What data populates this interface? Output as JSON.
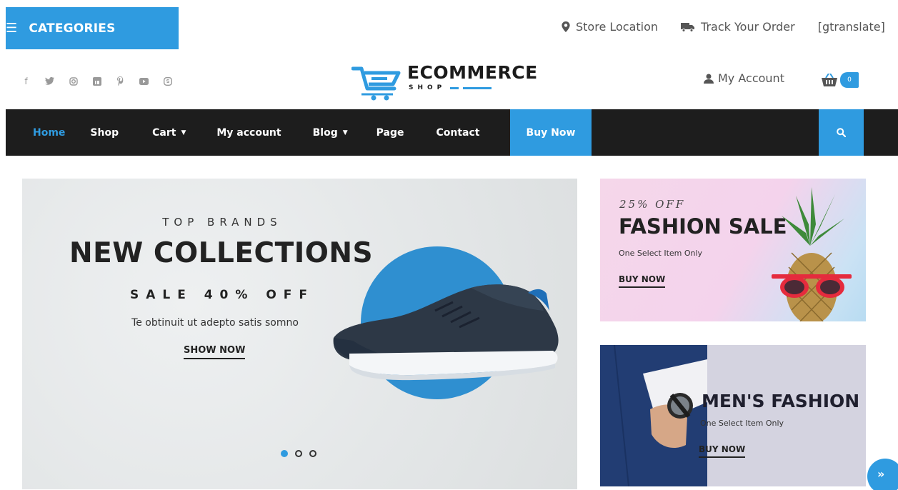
{
  "header": {
    "categories_label": "CATEGORIES",
    "store_location": "Store Location",
    "track_order": "Track Your Order",
    "translate": "[gtranslate]",
    "my_account": "My Account",
    "cart_count": "0"
  },
  "logo": {
    "main": "ECOMMERCE",
    "sub": "SHOP"
  },
  "social_icons": [
    "facebook-icon",
    "twitter-icon",
    "instagram-icon",
    "linkedin-icon",
    "pinterest-icon",
    "youtube-icon",
    "skype-icon"
  ],
  "nav": {
    "items": [
      {
        "label": "Home",
        "dropdown": false
      },
      {
        "label": "Shop",
        "dropdown": false
      },
      {
        "label": "Cart",
        "dropdown": true
      },
      {
        "label": "My account",
        "dropdown": false
      },
      {
        "label": "Blog",
        "dropdown": true
      },
      {
        "label": "Page",
        "dropdown": false
      },
      {
        "label": "Contact",
        "dropdown": false
      }
    ],
    "buy_now": "Buy Now"
  },
  "hero": {
    "kicker": "TOP BRANDS",
    "title": "NEW COLLECTIONS",
    "sale": "SALE 40% OFF",
    "description": "Te obtinuit ut adepto satis somno",
    "cta": "SHOW NOW",
    "slide_count": 3,
    "active_slide": 1
  },
  "banners": [
    {
      "offer": "25% OFF",
      "title": "FASHION SALE",
      "subtitle": "One Select Item Only",
      "cta": "BUY NOW"
    },
    {
      "title": "MEN'S FASHION",
      "subtitle": "One Select Item Only",
      "cta": "BUY NOW"
    }
  ],
  "colors": {
    "accent": "#2f9be0",
    "nav_bg": "#1d1d1d",
    "hero_bg": "#e6e9ea",
    "hero_circle": "#2f8fd0"
  }
}
